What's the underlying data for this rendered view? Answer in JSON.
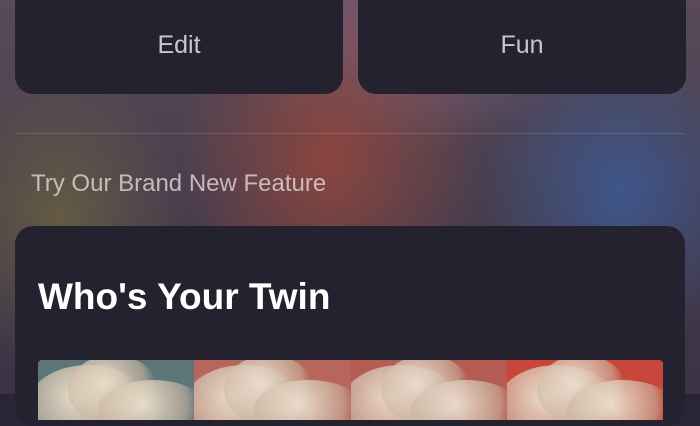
{
  "top_cards": {
    "edit_label": "Edit",
    "fun_label": "Fun"
  },
  "section": {
    "title": "Try Our Brand New Feature"
  },
  "feature": {
    "title": "Who's Your Twin",
    "thumbnails": [
      {
        "bg": "#5d7479",
        "hair": "#e7dcc8"
      },
      {
        "bg": "#b6665a",
        "hair": "#e9dccb"
      },
      {
        "bg": "#b55d53",
        "hair": "#ead9ca"
      },
      {
        "bg": "#c8473a",
        "hair": "#ecdccc"
      }
    ]
  },
  "colors": {
    "card_bg": "#25222f",
    "muted_text": "#c9c6cf",
    "title_text": "#ffffff"
  }
}
